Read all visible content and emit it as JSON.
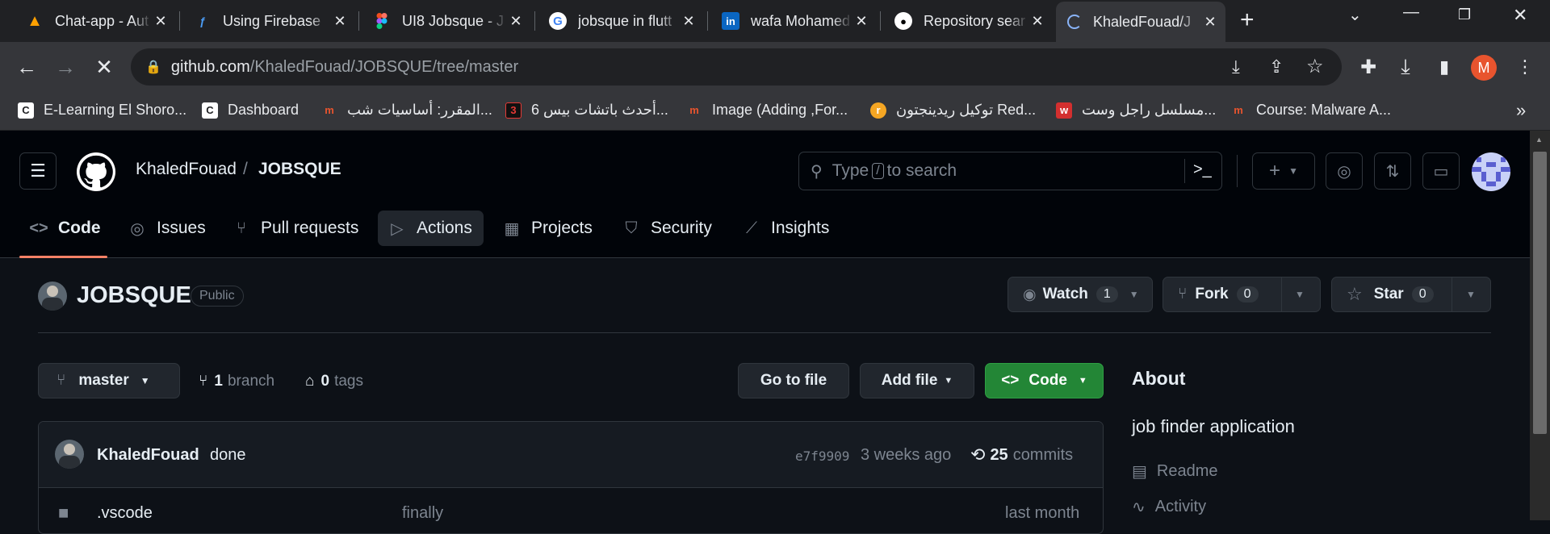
{
  "browser": {
    "tabs": [
      {
        "title": "Chat-app - Aut",
        "icon": "firebase-icon"
      },
      {
        "title": "Using Firebase",
        "icon": "flutterflow-icon"
      },
      {
        "title": "UI8 Jobsque - J",
        "icon": "figma-icon"
      },
      {
        "title": "jobsque in flutt",
        "icon": "google-icon"
      },
      {
        "title": "wafa Mohamed",
        "icon": "linkedin-icon"
      },
      {
        "title": "Repository sear",
        "icon": "github-icon"
      },
      {
        "title": "KhaledFouad/J",
        "icon": "loading-icon"
      }
    ],
    "new_tab": "+",
    "url_host": "github.com",
    "url_path": "/KhaledFouad/JOBSQUE/tree/master",
    "profile_initial": "M",
    "bookmarks": [
      {
        "label": "E-Learning El Shoro...",
        "icon": "C"
      },
      {
        "label": "Dashboard",
        "icon": "C"
      },
      {
        "label": "المقرر: أساسيات شب...",
        "icon": "m"
      },
      {
        "label": "أحدث باتشات بيس 6...",
        "icon": "3"
      },
      {
        "label": "Image (Adding ,For...",
        "icon": "m"
      },
      {
        "label": "توكيل ريدينجتون Red...",
        "icon": "r"
      },
      {
        "label": "مسلسل راجل وست...",
        "icon": "w"
      },
      {
        "label": "Course: Malware A...",
        "icon": "m"
      }
    ],
    "bookmarks_more": "»"
  },
  "github": {
    "owner": "KhaledFouad",
    "separator": "/",
    "repo": "JOBSQUE",
    "search_prefix": "Type",
    "search_key": "/",
    "search_suffix": "to search",
    "repo_tabs": [
      {
        "label": "Code",
        "icon": "code-icon"
      },
      {
        "label": "Issues",
        "icon": "issue-icon"
      },
      {
        "label": "Pull requests",
        "icon": "pull-request-icon"
      },
      {
        "label": "Actions",
        "icon": "play-icon"
      },
      {
        "label": "Projects",
        "icon": "table-icon"
      },
      {
        "label": "Security",
        "icon": "shield-icon"
      },
      {
        "label": "Insights",
        "icon": "graph-icon"
      }
    ],
    "visibility": "Public",
    "watch": {
      "label": "Watch",
      "count": "1"
    },
    "fork": {
      "label": "Fork",
      "count": "0"
    },
    "star": {
      "label": "Star",
      "count": "0"
    },
    "branch_select": "master",
    "branch_count": "1",
    "branch_word": "branch",
    "tag_count": "0",
    "tag_word": "tags",
    "go_to_file": "Go to file",
    "add_file": "Add file",
    "code_button": "Code",
    "commit": {
      "author": "KhaledFouad",
      "message": "done",
      "sha": "e7f9909",
      "time": "3 weeks ago",
      "count": "25",
      "count_word": "commits"
    },
    "files": [
      {
        "name": ".vscode",
        "message": "finally",
        "time": "last month"
      }
    ],
    "about": {
      "heading": "About",
      "description": "job finder application",
      "links": [
        {
          "label": "Readme",
          "icon": "book-icon"
        },
        {
          "label": "Activity",
          "icon": "pulse-icon"
        }
      ]
    },
    "colors": {
      "accent_green": "#238636",
      "underline": "#f78166",
      "bg": "#0d1117"
    }
  }
}
